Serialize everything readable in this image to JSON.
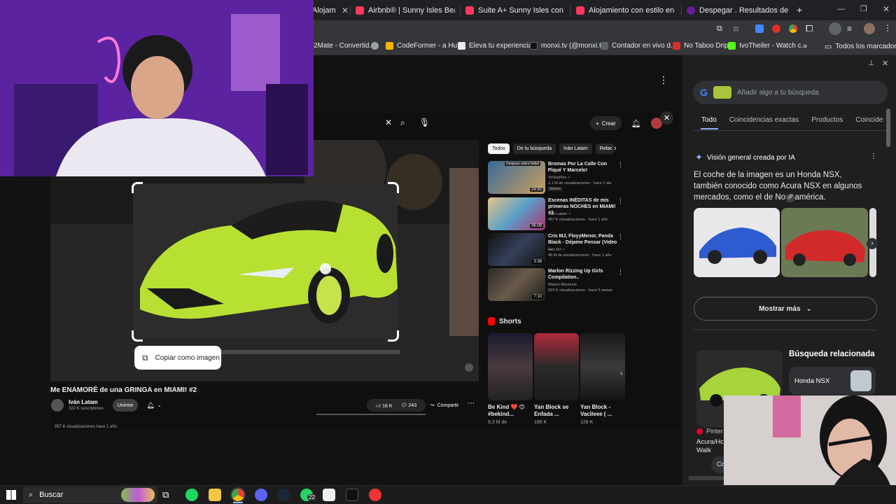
{
  "browser": {
    "tabs": [
      {
        "label": "Alojam",
        "color": "#ff385c"
      },
      {
        "label": "Airbnb® | Sunny Isles Beach: A",
        "color": "#ff385c"
      },
      {
        "label": "Suite A+ Sunny Isles con vista",
        "color": "#ff385c"
      },
      {
        "label": "Alojamiento con estilo en el m",
        "color": "#ff385c"
      },
      {
        "label": "Despegar . Resultados de Vuel",
        "color": "#6a1b9a"
      }
    ],
    "new_tab_glyph": "+",
    "bookmarks": [
      {
        "label": "2Mate - Convertid...",
        "color": ""
      },
      {
        "label": "CodeFormer - a Hu...",
        "color": "#f4b400"
      },
      {
        "label": "Eleva tu experiencia...",
        "color": "#e8eaed"
      },
      {
        "label": "monxi.tv (@monxi.t...",
        "color": "#000000"
      },
      {
        "label": "Contador en vivo d...",
        "color": "#5f6368"
      },
      {
        "label": "No Taboo Drip",
        "color": "#d93025"
      },
      {
        "label": "IvoTheiler - Watch c...",
        "color": "#53fc18"
      }
    ],
    "bookmarks_overflow": "»",
    "all_bookmarks": "Todos los marcadores"
  },
  "youtube": {
    "create_label": "Crear",
    "video_title": "Me ENAMORÉ de una GRINGA en MIAMI! #2",
    "channel": "Iván Latam",
    "subscribers": "322 K suscriptores",
    "join": "Unirme",
    "likes": "16 K",
    "comments": "243",
    "share": "Compartir",
    "views": "857 K visualizaciones  hace 1 año",
    "copy_image": "Copiar como imagen",
    "chips": [
      "Todos",
      "De tu búsqueda",
      "Iván Latam",
      "Relac"
    ],
    "recommendations": [
      {
        "title": "Bromas Por La Calle Con Piqué Y Marcelo!",
        "channel": "YoSoyPlex",
        "meta": "1,1 M de visualizaciones · hace 1 día",
        "badge": "Nuevo",
        "duration": "24:50",
        "thumb_tag": "Despues sobre futbol"
      },
      {
        "title": "Escenas INÉDITAS de mis primeras NOCHES en MIAMI! #3",
        "channel": "Iván Latam",
        "meta": "457 K visualizaciones · hace 1 año",
        "badge": "",
        "duration": "36:09",
        "thumb_tag": ""
      },
      {
        "title": "Cris MJ, FloyyMenor, Panda Black - Déjame Pensar (Video ...",
        "channel": "Cris MJ",
        "meta": "45 M de visualizaciones · hace 1 año",
        "badge": "",
        "duration": "3:38",
        "thumb_tag": ""
      },
      {
        "title": "Marlon Rizzing Up Girls Compilation..",
        "channel": "Marlon Moments",
        "meta": "923 K visualizaciones · hace 5 meses",
        "badge": "",
        "duration": "7:10",
        "thumb_tag": ""
      }
    ],
    "shorts_label": "Shorts",
    "shorts": [
      {
        "title": "Be Kind ❤️ 😊 #bekind...",
        "views": "8,3 M de"
      },
      {
        "title": "Yan Block se Enfada ...",
        "views": "186 K"
      },
      {
        "title": "Yan Block - Vacileee ( ...",
        "views": "128 K"
      }
    ]
  },
  "google_panel": {
    "search_placeholder": "Añadir algo a tu búsqueda",
    "tabs": [
      "Todo",
      "Coincidencias exactas",
      "Productos",
      "Coincidenc"
    ],
    "ai_header": "Visión general creada por IA",
    "ai_text": "El coche de la imagen es un Honda NSX, también conocido como Acura NSX en algunos mercados, como el de Norteamérica.",
    "show_more": "Mostrar más",
    "related_header": "Búsqueda relacionada",
    "related_item": "Honda NSX",
    "source_site": "Pinter",
    "source_caption": "Acura/Ho Walk",
    "bottom_clip": "Co",
    "accent": "#8ab4f8"
  },
  "taskbar": {
    "search_label": "Buscar",
    "whatsapp_badge": "22"
  }
}
